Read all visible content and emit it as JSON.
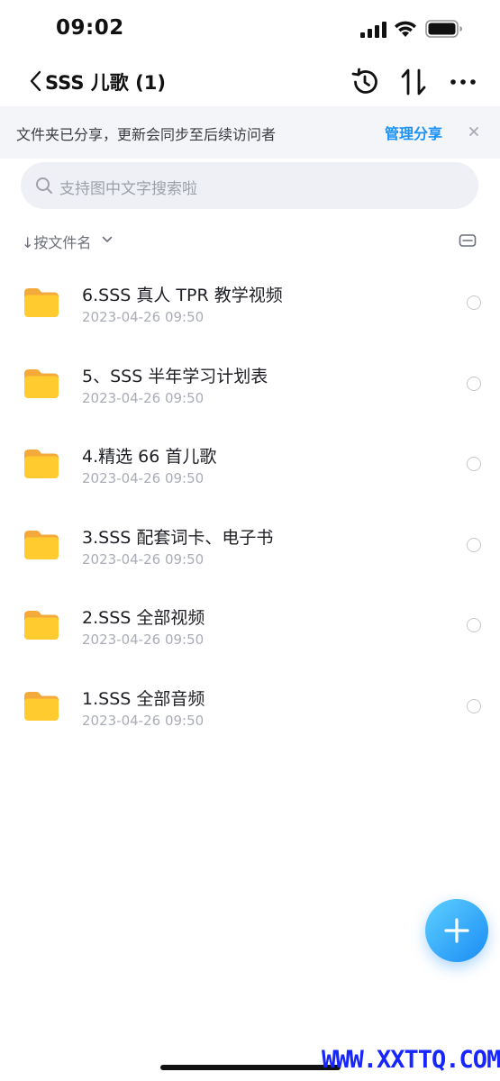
{
  "status_bar": {
    "time": "09:02"
  },
  "nav": {
    "title": "SSS 儿歌 (1)"
  },
  "share_banner": {
    "text": "文件夹已分享，更新会同步至后续访问者",
    "action_label": "管理分享",
    "close_symbol": "×"
  },
  "search": {
    "placeholder": "支持图中文字搜索啦"
  },
  "sort": {
    "label": "↓按文件名"
  },
  "files": [
    {
      "name": "6.SSS 真人 TPR 教学视频",
      "date": "2023-04-26 09:50"
    },
    {
      "name": "5、SSS 半年学习计划表",
      "date": "2023-04-26 09:50"
    },
    {
      "name": "4.精选 66 首儿歌",
      "date": "2023-04-26 09:50"
    },
    {
      "name": "3.SSS 配套词卡、电子书",
      "date": "2023-04-26 09:50"
    },
    {
      "name": "2.SSS 全部视频",
      "date": "2023-04-26 09:50"
    },
    {
      "name": "1.SSS 全部音频",
      "date": "2023-04-26 09:50"
    }
  ],
  "watermark": "WWW.XXTTQ.COM",
  "colors": {
    "accent": "#1a92f5",
    "folder": "#ffcb2f",
    "banner_bg": "#f4f5f8",
    "search_bg": "#eef0f6"
  },
  "icons": {
    "back": "chevron-left-icon",
    "history": "history-icon",
    "sort": "sort-arrows-icon",
    "more": "more-horizontal-icon",
    "search": "search-icon",
    "view_toggle": "list-view-icon",
    "folder": "folder-icon",
    "add": "plus-icon"
  }
}
